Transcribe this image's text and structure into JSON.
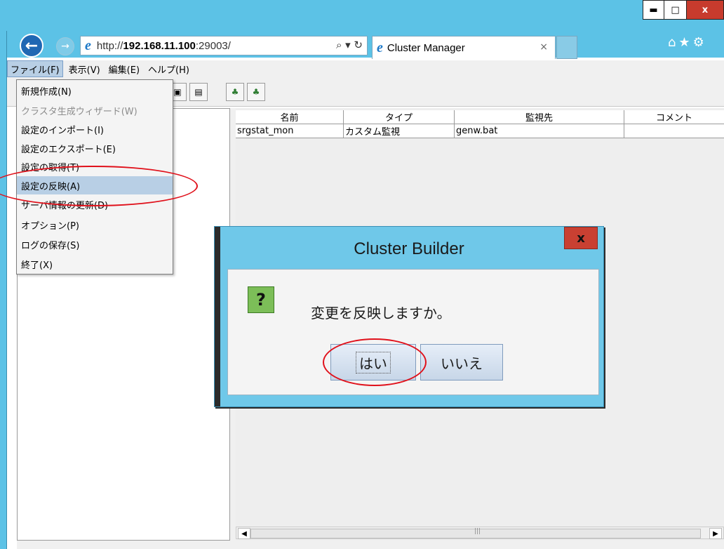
{
  "window": {
    "min": "▬",
    "max": "□",
    "close": "x"
  },
  "browser": {
    "url_prefix": "http://",
    "url_host": "192.168.11.100",
    "url_port": ":29003/",
    "search_refresh": "⌕ ▾ ↻",
    "tab_title": "Cluster Manager",
    "tab_close": "×",
    "right_icons": "⌂★⚙"
  },
  "menubar": {
    "items": [
      "ファイル(F)",
      "表示(V)",
      "編集(E)",
      "ヘルプ(H)"
    ]
  },
  "file_menu": {
    "items": [
      {
        "label": "新規作成(N)"
      },
      {
        "label": "クラスタ生成ウィザード(W)"
      },
      {
        "label": "設定のインポート(I)"
      },
      {
        "label": "設定のエクスポート(E)"
      },
      {
        "label": "設定の取得(T)"
      },
      {
        "label": "設定の反映(A)"
      },
      {
        "label": "サーバ情報の更新(D)"
      },
      {
        "label": "オプション(P)"
      },
      {
        "label": "ログの保存(S)"
      },
      {
        "label": "終了(X)"
      }
    ]
  },
  "grid": {
    "headers": [
      "名前",
      "タイプ",
      "監視先",
      "コメント"
    ],
    "rows": [
      [
        "srgstat_mon",
        "カスタム監視",
        "genw.bat",
        ""
      ]
    ]
  },
  "scrollbar": {
    "left": "◀",
    "right": "▶",
    "grip": "|||"
  },
  "dialog": {
    "title": "Cluster Builder",
    "close": "x",
    "icon": "?",
    "message": "変更を反映しますか。",
    "yes": "はい",
    "no": "いいえ"
  },
  "colors": {
    "chrome": "#5cc2e6",
    "menu_highlight": "#b8cfe5",
    "annotation": "#e0111b",
    "close_button": "#c73b2d"
  }
}
